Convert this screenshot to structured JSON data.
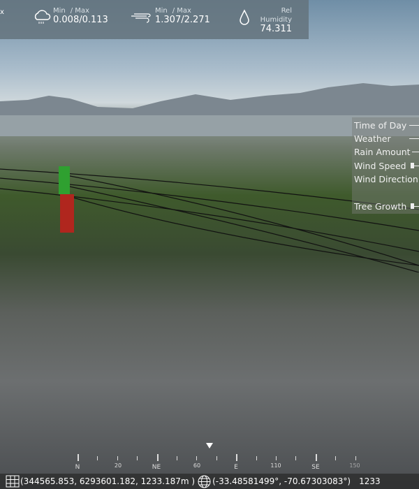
{
  "weather_bar": {
    "partial_left": "x",
    "rain": {
      "icon": "rain-cloud-icon",
      "min_label": "Min",
      "max_label": "/ Max",
      "value": "0.008/0.113"
    },
    "wind": {
      "icon": "wind-icon",
      "min_label": "Min",
      "max_label": "/ Max",
      "value": "1.307/2.271"
    },
    "humidity": {
      "icon": "water-drop-icon",
      "label": "Rel Humidity",
      "value": "74.311"
    }
  },
  "controls": {
    "items": [
      {
        "label": "Time of Day"
      },
      {
        "label": "Weather"
      },
      {
        "label": "Rain Amount"
      },
      {
        "label": "Wind Speed"
      },
      {
        "label": "Wind Direction"
      },
      {
        "label": "Tree Growth"
      }
    ]
  },
  "compass": {
    "labels": [
      "N",
      "20",
      "NE",
      "60",
      "E",
      "110",
      "SE",
      "150"
    ]
  },
  "coords": {
    "grid_icon": "grid-icon",
    "utm": "(344565.853, 6293601.182, 1233.187m )",
    "globe_icon": "globe-icon",
    "latlon": "(-33.48581499°, -70.67303083°)",
    "elevation": "1233"
  }
}
